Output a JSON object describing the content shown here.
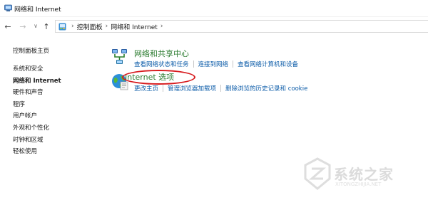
{
  "window": {
    "title": "网络和 Internet"
  },
  "navigation": {
    "back_glyph": "←",
    "forward_glyph": "→",
    "recent_glyph": "∨",
    "up_glyph": "↑"
  },
  "address_bar": {
    "crumbs": [
      "控制面板",
      "网络和 Internet"
    ],
    "separator": "›"
  },
  "sidebar": {
    "items": [
      {
        "label": "控制面板主页",
        "active": false
      },
      {
        "label": "系统和安全",
        "active": false
      },
      {
        "label": "网络和 Internet",
        "active": true
      },
      {
        "label": "硬件和声音",
        "active": false
      },
      {
        "label": "程序",
        "active": false
      },
      {
        "label": "用户帐户",
        "active": false
      },
      {
        "label": "外观和个性化",
        "active": false
      },
      {
        "label": "时钟和区域",
        "active": false
      },
      {
        "label": "轻松使用",
        "active": false
      }
    ]
  },
  "categories": [
    {
      "title": "网络和共享中心",
      "icon": "network-sharing-icon",
      "links": [
        "查看网络状态和任务",
        "连接到网络",
        "查看网络计算机和设备"
      ]
    },
    {
      "title": "Internet 选项",
      "icon": "internet-globe-icon",
      "links": [
        "更改主页",
        "管理浏览器加载项",
        "删除浏览的历史记录和 cookie"
      ]
    }
  ],
  "annotation": {
    "color": "#d7191c"
  },
  "watermark": {
    "text": "系统之家",
    "sub": "XITONGZHIJIA.NET"
  },
  "colors": {
    "category_title": "#2e7d32",
    "link": "#0b5ba8"
  }
}
